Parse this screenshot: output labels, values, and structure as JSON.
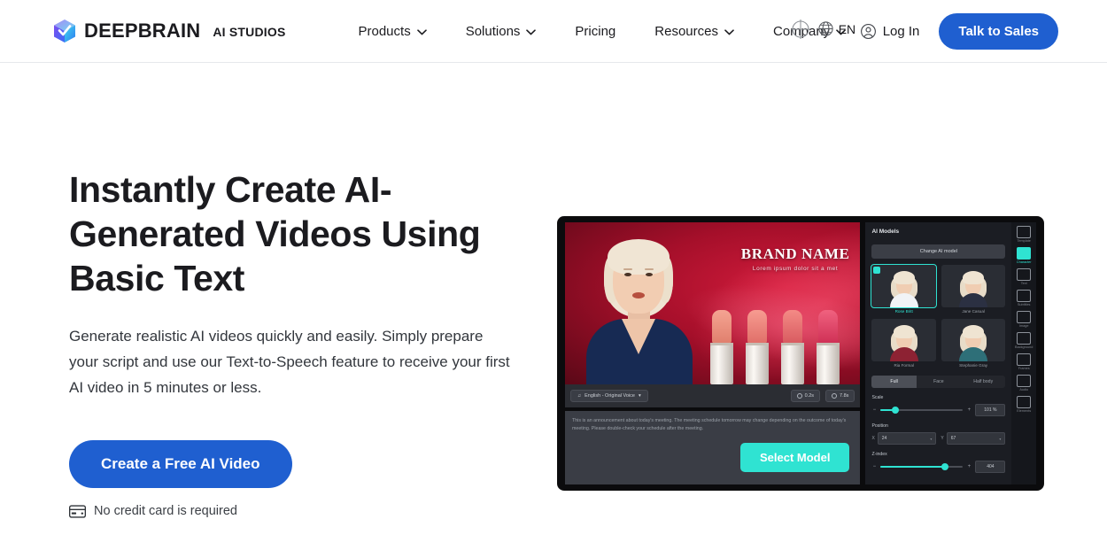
{
  "header": {
    "brand": {
      "name": "DEEPBRAIN",
      "suffix": "AI STUDIOS",
      "icon": "cube-logo-icon"
    },
    "nav": [
      {
        "label": "Products",
        "has_caret": true
      },
      {
        "label": "Solutions",
        "has_caret": true
      },
      {
        "label": "Pricing",
        "has_caret": false
      },
      {
        "label": "Resources",
        "has_caret": true
      },
      {
        "label": "Company",
        "has_caret": true
      }
    ],
    "language": {
      "label": "EN",
      "icon": "globe-icon"
    },
    "login": {
      "label": "Log In",
      "icon": "user-circle-icon"
    },
    "cta": {
      "label": "Talk to Sales",
      "color": "#1f5fd0"
    }
  },
  "hero": {
    "headline": "Instantly Create AI-Generated Videos Using Basic Text",
    "subcopy": "Generate realistic AI videos quickly and easily. Simply prepare your script and use our Text-to-Speech feature to receive your first AI video in 5 minutes or less.",
    "cta_label": "Create a Free AI Video",
    "note": "No credit card is required",
    "note_icon": "credit-card-icon"
  },
  "product_shot": {
    "stage": {
      "brand_title": "BRAND NAME",
      "brand_subtitle": "Lorem ipsum dolor sit a met"
    },
    "toolbar": {
      "voice_chip": "English - Original Voice",
      "duration_chip": "0.2s",
      "total_chip": "7.8s"
    },
    "script_text": "This is an announcement about today's meeting. The meeting schedule tomorrow may change depending on the outcome of today's meeting. Please double-check your schedule after the meeting.",
    "select_model_button": "Select Model",
    "panel": {
      "title": "AI Models",
      "change_button": "Change AI model",
      "models": [
        {
          "name": "Rose Britt",
          "selected": true,
          "outfit": "#f1f3f6"
        },
        {
          "name": "Jane Casual",
          "selected": false,
          "outfit": "#2b3042"
        },
        {
          "name": "Ria Formal",
          "selected": false,
          "outfit": "#8d2233"
        },
        {
          "name": "Stephanie Gray",
          "selected": false,
          "outfit": "#2e6f78"
        }
      ],
      "segments": [
        {
          "label": "Full",
          "active": true
        },
        {
          "label": "Face",
          "active": false
        },
        {
          "label": "Half body",
          "active": false
        }
      ],
      "controls": [
        {
          "label": "Scale",
          "value": "101 %"
        },
        {
          "label": "Position",
          "x": "24",
          "y": "67"
        },
        {
          "label": "Z-index",
          "value": "404"
        }
      ]
    },
    "rail": [
      {
        "label": "Template",
        "icon": "template-icon",
        "active": false
      },
      {
        "label": "Character",
        "icon": "character-icon",
        "active": true
      },
      {
        "label": "Text",
        "icon": "text-icon",
        "active": false
      },
      {
        "label": "Subtitles",
        "icon": "subtitles-icon",
        "active": false
      },
      {
        "label": "Image",
        "icon": "image-icon",
        "active": false
      },
      {
        "label": "Background",
        "icon": "background-icon",
        "active": false
      },
      {
        "label": "Frames",
        "icon": "frames-icon",
        "active": false
      },
      {
        "label": "Audio",
        "icon": "audio-icon",
        "active": false
      },
      {
        "label": "Elements",
        "icon": "elements-icon",
        "active": false
      }
    ]
  },
  "colors": {
    "accent_blue": "#1f5fd0",
    "accent_teal": "#2fe3d2",
    "text_dark": "#1b1b1f"
  }
}
